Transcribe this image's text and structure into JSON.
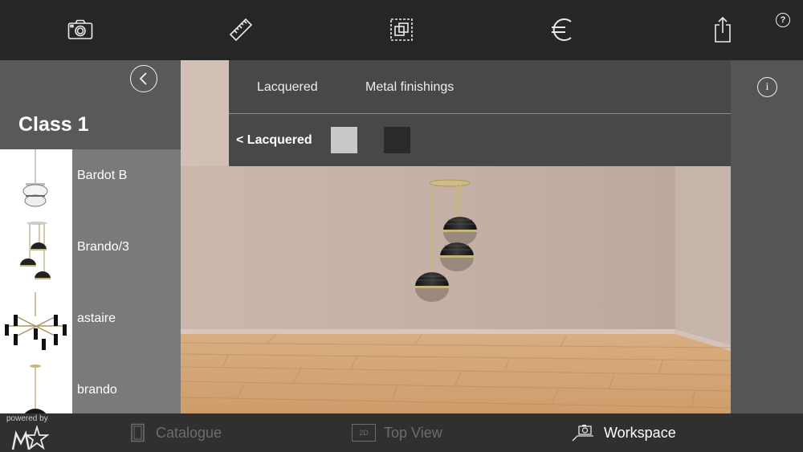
{
  "toolbar": {
    "buttons": [
      "camera-icon",
      "ruler-icon",
      "layers-icon",
      "euro-icon",
      "share-icon"
    ],
    "help_label": "?"
  },
  "left_panel": {
    "class_title": "Class 1",
    "products": [
      {
        "name": "Bardot B"
      },
      {
        "name": "Brando/3"
      },
      {
        "name": "astaire"
      },
      {
        "name": "brando"
      }
    ]
  },
  "finish_panel": {
    "tabs": [
      "Lacquered",
      "Metal finishings"
    ],
    "back_label": "< Lacquered",
    "swatches": [
      {
        "name": "light-grey",
        "color": "#c8c8c8"
      },
      {
        "name": "black",
        "color": "#2a2a2a"
      }
    ]
  },
  "info_label": "i",
  "bottom_nav": {
    "powered_by": "powered by",
    "items": [
      {
        "label": "Catalogue",
        "active": false
      },
      {
        "label": "Top View",
        "icon_text": "2D",
        "active": false
      },
      {
        "label": "Workspace",
        "active": true
      }
    ]
  },
  "colors": {
    "toolbar_bg": "#262626",
    "wall": "#cbb5ab",
    "floor": "#d6a877",
    "accent_brass": "#c9b57a"
  }
}
